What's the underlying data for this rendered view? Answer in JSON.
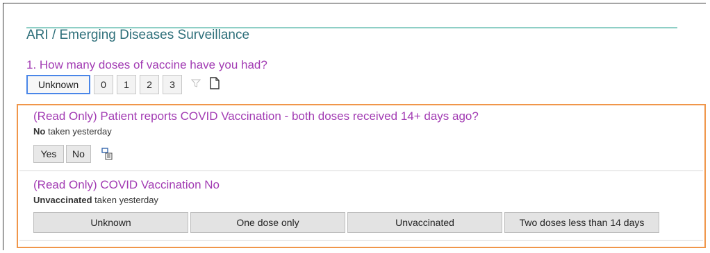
{
  "section": {
    "title": "ARI / Emerging Diseases Surveillance"
  },
  "question1": {
    "text": "1. How many doses of vaccine have you had?",
    "options": [
      "Unknown",
      "0",
      "1",
      "2",
      "3"
    ],
    "selected": "Unknown"
  },
  "readonly1": {
    "title": "(Read Only) Patient reports COVID Vaccination - both doses received 14+ days ago?",
    "note_bold": "No",
    "note_rest": " taken yesterday",
    "options": [
      "Yes",
      "No"
    ]
  },
  "readonly2": {
    "title": "(Read Only) COVID Vaccination No",
    "note_bold": "Unvaccinated",
    "note_rest": " taken yesterday",
    "options": [
      "Unknown",
      "One dose only",
      "Unvaccinated",
      "Two doses less than 14 days"
    ]
  },
  "colors": {
    "purple_text": "#a23bb3",
    "teal_title": "#2e6f7a",
    "orange_border": "#f0964a",
    "selected_border": "#4a86e8"
  },
  "icons": [
    "filter-icon",
    "document-icon",
    "copy-list-icon"
  ]
}
